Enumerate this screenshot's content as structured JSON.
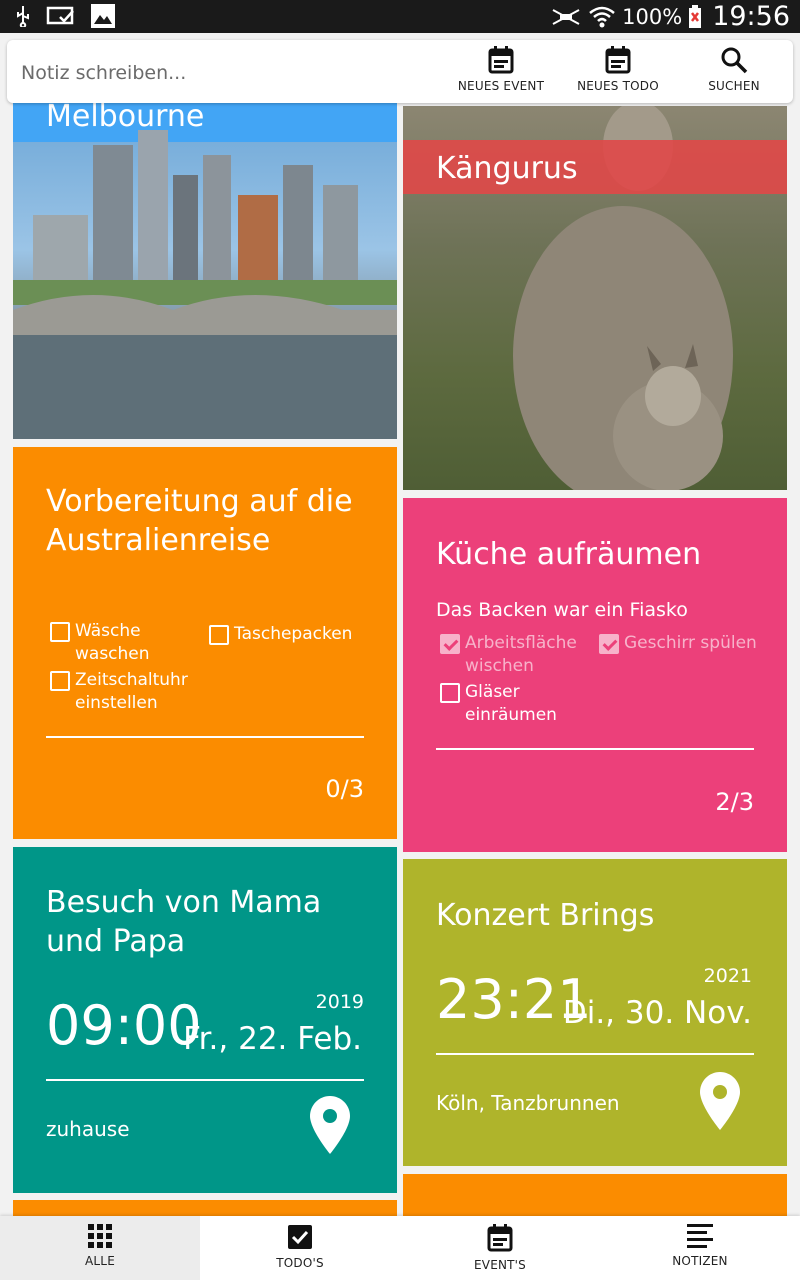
{
  "status_bar": {
    "icons": [
      "usb-icon",
      "cast-icon",
      "image-icon",
      "mute-icon",
      "wifi-icon",
      "battery-icon"
    ],
    "battery": "100%",
    "time": "19:56"
  },
  "top_bar": {
    "note_placeholder": "Notiz schreiben...",
    "actions": [
      {
        "label": "NEUES EVENT",
        "icon": "calendar-icon"
      },
      {
        "label": "NEUES TODO",
        "icon": "calendar-icon"
      },
      {
        "label": "SUCHEN",
        "icon": "search-icon"
      }
    ]
  },
  "cards": {
    "melbourne": {
      "title": "Melbourne",
      "color": "#42a5f5"
    },
    "kangaroos": {
      "title": "Kängurus",
      "color": "#e04848"
    },
    "australia": {
      "title": "Vorbereitung auf die Australienreise",
      "color": "#fb8c00",
      "items": [
        {
          "label": "Wäsche waschen",
          "done": false
        },
        {
          "label": "Taschepacken",
          "done": false
        },
        {
          "label": "Zeitschaltuhr einstellen",
          "done": false
        }
      ],
      "progress": "0/3"
    },
    "kitchen": {
      "title": "Küche aufräumen",
      "subtitle": "Das Backen war ein Fiasko",
      "color": "#ec407a",
      "items": [
        {
          "label": "Arbeitsfläche wischen",
          "done": true
        },
        {
          "label": "Geschirr spülen",
          "done": true
        },
        {
          "label": "Gläser einräumen",
          "done": false
        }
      ],
      "progress": "2/3"
    },
    "visit": {
      "title": "Besuch von Mama und Papa",
      "color": "#009688",
      "year": "2019",
      "time": "09:00",
      "date": "Fr., 22. Feb.",
      "location": "zuhause"
    },
    "concert": {
      "title": "Konzert Brings",
      "color": "#afb42b",
      "year": "2021",
      "time": "23:21",
      "date": "Di., 30. Nov.",
      "location": "Köln, Tanzbrunnen"
    },
    "partial_left": {
      "color": "#fb8c00"
    },
    "partial_right": {
      "color": "#fb8c00"
    }
  },
  "bottom_nav": {
    "items": [
      {
        "label": "ALLE",
        "icon": "grid-icon",
        "active": true
      },
      {
        "label": "TODO'S",
        "icon": "checkbox-icon",
        "active": false
      },
      {
        "label": "EVENT'S",
        "icon": "calendar-icon",
        "active": false
      },
      {
        "label": "NOTIZEN",
        "icon": "notes-icon",
        "active": false
      }
    ]
  }
}
